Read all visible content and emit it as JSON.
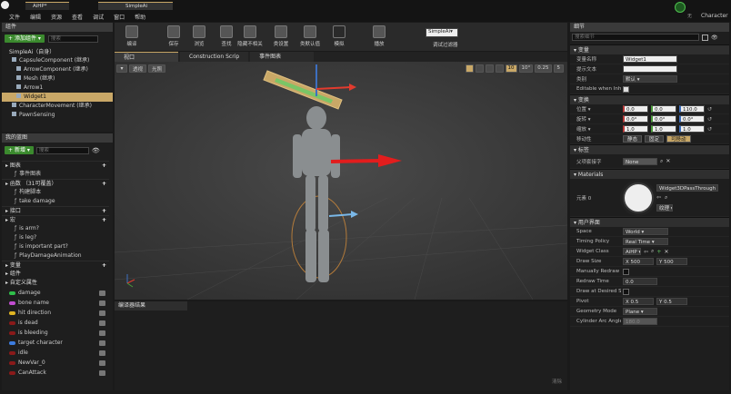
{
  "menubar": {
    "items": [
      "文件",
      "编辑",
      "资源",
      "查看",
      "调试",
      "窗口",
      "帮助"
    ],
    "window_tab": "AiHP*",
    "tab_title": "SimpleAi",
    "right_label": "Character",
    "user_label": "无"
  },
  "components": {
    "title": "组件",
    "add_label": "添加组件",
    "search_placeholder": "搜索",
    "root": "SimpleAi（自身）",
    "items": [
      {
        "label": "CapsuleComponent (继承)",
        "indent": 1
      },
      {
        "label": "ArrowComponent (继承)",
        "indent": 2
      },
      {
        "label": "Mesh (继承)",
        "indent": 2
      },
      {
        "label": "Arrow1",
        "indent": 2
      },
      {
        "label": "Widget1",
        "indent": 2,
        "selected": true
      },
      {
        "label": "CharacterMovement (继承)",
        "indent": 1
      },
      {
        "label": "PawnSensing",
        "indent": 1
      }
    ]
  },
  "mybp": {
    "title": "我的蓝图",
    "new_label": "新增",
    "search_placeholder": "搜索",
    "sections": [
      {
        "label": "图表",
        "items": [
          "事件图表"
        ]
      },
      {
        "label": "函数",
        "hint": "（31可覆盖）",
        "items": [
          "构建脚本",
          "take damage"
        ]
      },
      {
        "label": "接口",
        "items": []
      },
      {
        "label": "宏",
        "items": [
          "is arm?",
          "is leg?",
          "is important part?",
          "PlayDamageAnimation"
        ]
      },
      {
        "label": "变量",
        "items": []
      }
    ],
    "var_groups": [
      "组件",
      "自定义属性"
    ],
    "variables": [
      {
        "name": "damage",
        "color": "#2fbf4a"
      },
      {
        "name": "bone name",
        "color": "#c24dd0"
      },
      {
        "name": "hit direction",
        "color": "#e0b422"
      },
      {
        "name": "is dead",
        "color": "#8a1a1a"
      },
      {
        "name": "is bleeding",
        "color": "#8a1a1a"
      },
      {
        "name": "target character",
        "color": "#3d7de0"
      },
      {
        "name": "idle",
        "color": "#8a1a1a"
      },
      {
        "name": "NewVar_0",
        "color": "#8a1a1a"
      },
      {
        "name": "CanAttack",
        "color": "#8a1a1a"
      }
    ]
  },
  "toolbar": {
    "buttons": [
      "编译",
      "保存",
      "浏览",
      "查找",
      "隐藏不相关",
      "类设置",
      "类默认值",
      "模拟",
      "播放"
    ],
    "debug_select": "SimpleAi▾",
    "debug_label": "调试过滤器"
  },
  "editor_tabs": [
    "视口",
    "Construction Scrip",
    "事件图表"
  ],
  "viewport": {
    "view_mode": "透视",
    "lighting": "光照",
    "grid_snap": "10",
    "rot_snap": "10°",
    "scale_snap": "0.25",
    "cam_speed": "5"
  },
  "compiler": {
    "title": "编译器结果",
    "clear": "清除"
  },
  "details": {
    "title": "细节",
    "search_placeholder": "搜索细节",
    "variable_section": "变量",
    "var_name_label": "变量名称",
    "var_name": "Widget1",
    "tooltip_label": "提示文本",
    "category_label": "类别",
    "category_value": "默认",
    "editable_label": "Editable when Inheri",
    "transform_section": "变换",
    "location_label": "位置",
    "location": [
      "0.0",
      "0.0",
      "110.0"
    ],
    "rotation_label": "旋转",
    "rotation": [
      "0.0°",
      "0.0°",
      "0.0°"
    ],
    "scale_label": "缩放",
    "scale": [
      "1.0",
      "1.0",
      "1.0"
    ],
    "mobility_label": "移动性",
    "mobility": [
      "静态",
      "固定",
      "可移动"
    ],
    "tags_section": "标签",
    "parent_socket_label": "父项套接字",
    "parent_socket_value": "None",
    "materials_section": "Materials",
    "element_label": "元素 0",
    "material_value": "Widget3DPassThrough_M",
    "texture_label": "纹理",
    "ui_section": "用户界面",
    "space_label": "Space",
    "space_value": "World",
    "timing_label": "Timing Policy",
    "timing_value": "Real Time",
    "widget_class_label": "Widget Class",
    "widget_class_value": "AiHP",
    "draw_size_label": "Draw Size",
    "draw_size": [
      "500",
      "500"
    ],
    "manual_redraw_label": "Manually Redraw",
    "redraw_time_label": "Redraw Time",
    "redraw_time": "0.0",
    "draw_desired_label": "Draw at Desired Size",
    "pivot_label": "Pivot",
    "pivot": [
      "0.5",
      "0.5"
    ],
    "geometry_label": "Geometry Mode",
    "geometry_value": "Plane",
    "arc_label": "Cylinder Arc Angle",
    "arc_value": "180.0"
  },
  "colors": {
    "accent": "#c9a867",
    "add_green": "#3b8a2e",
    "x_red": "#b83a3a",
    "y_green": "#4b9a3a",
    "z_blue": "#3d6fc0"
  }
}
